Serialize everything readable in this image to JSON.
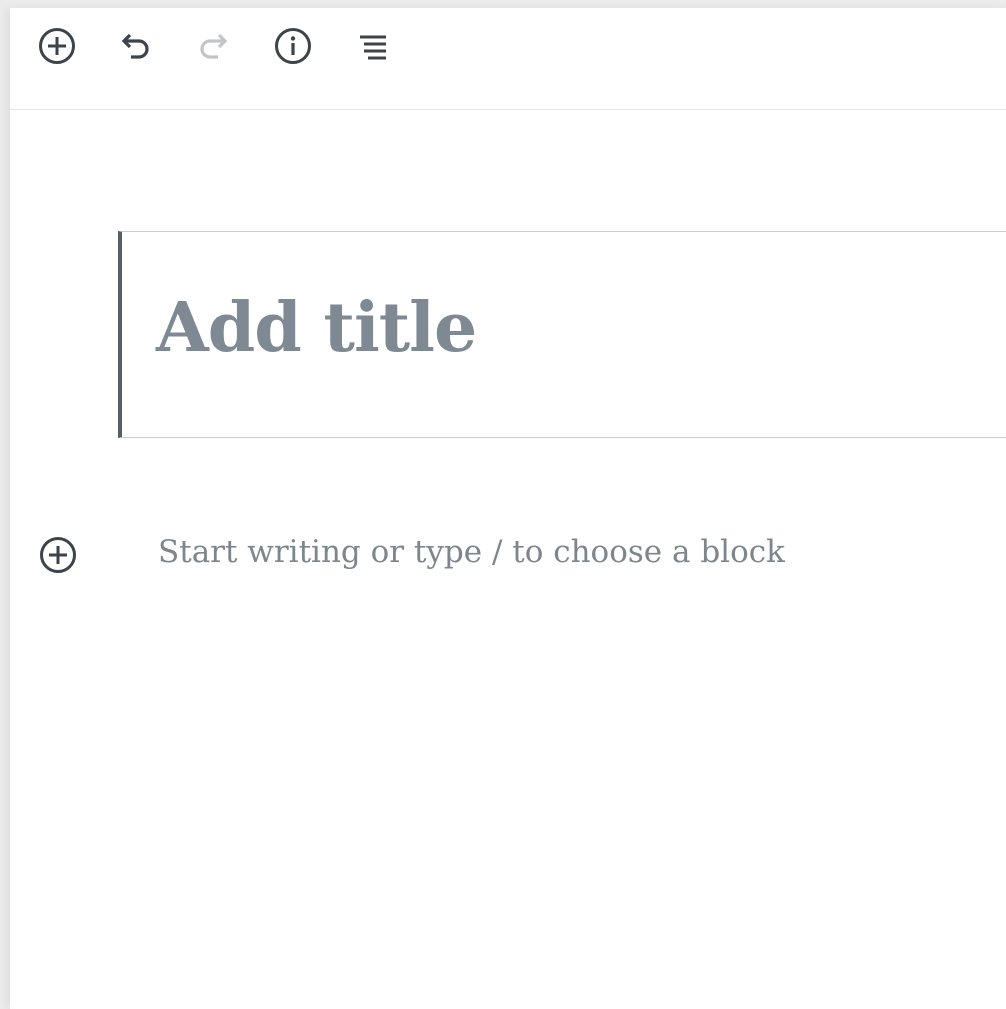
{
  "toolbar": {
    "items": [
      {
        "icon": "plus-circle-icon",
        "label": "Add block",
        "enabled": true
      },
      {
        "icon": "undo-icon",
        "label": "Undo",
        "enabled": true
      },
      {
        "icon": "redo-icon",
        "label": "Redo",
        "enabled": false
      },
      {
        "icon": "info-icon",
        "label": "Content structure",
        "enabled": true
      },
      {
        "icon": "list-view-icon",
        "label": "Block navigation",
        "enabled": true
      }
    ]
  },
  "editor": {
    "title_placeholder": "Add title",
    "paragraph_placeholder": "Start writing or type / to choose a block",
    "inline_inserter_icon": "plus-circle-icon"
  },
  "colors": {
    "icon_dark": "#3c434a",
    "icon_disabled": "#c3c4c7",
    "title_placeholder": "#7e8993",
    "body_placeholder": "#7e868d",
    "block_border": "#c6cfd3",
    "block_accent": "#555d66"
  }
}
